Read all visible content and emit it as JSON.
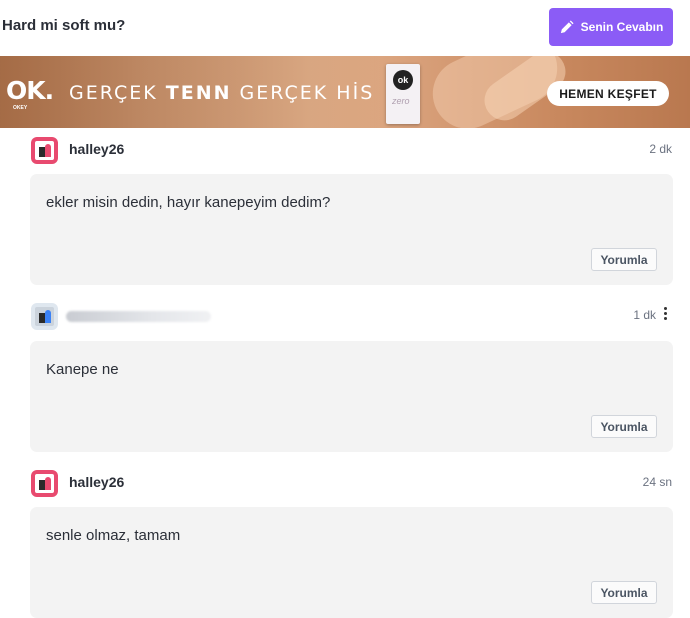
{
  "header": {
    "title": "Hard mi soft mu?",
    "answer_button": "Senin Cevabın"
  },
  "banner": {
    "logo": "OK.",
    "logo_sub": "OKEY",
    "slogan_part1": "GERÇEK ",
    "slogan_bold": "TENN",
    "slogan_part2": " GERÇEK HİS",
    "pack_logo": "ok",
    "pack_label": "zero",
    "cta": "HEMEN KEŞFET"
  },
  "posts": [
    {
      "username": "halley26",
      "time": "2 dk",
      "text": "ekler misin dedin, hayır kanepeyim dedim?",
      "comment": "Yorumla"
    },
    {
      "username": "",
      "time": "1 dk",
      "text": "Kanepe ne",
      "comment": "Yorumla"
    },
    {
      "username": "halley26",
      "time": "24 sn",
      "text": "senle olmaz, tamam",
      "comment": "Yorumla"
    }
  ],
  "colors": {
    "accent": "#8b5cf6",
    "avatar": "#e84a6f",
    "card": "#f3f3f3"
  }
}
